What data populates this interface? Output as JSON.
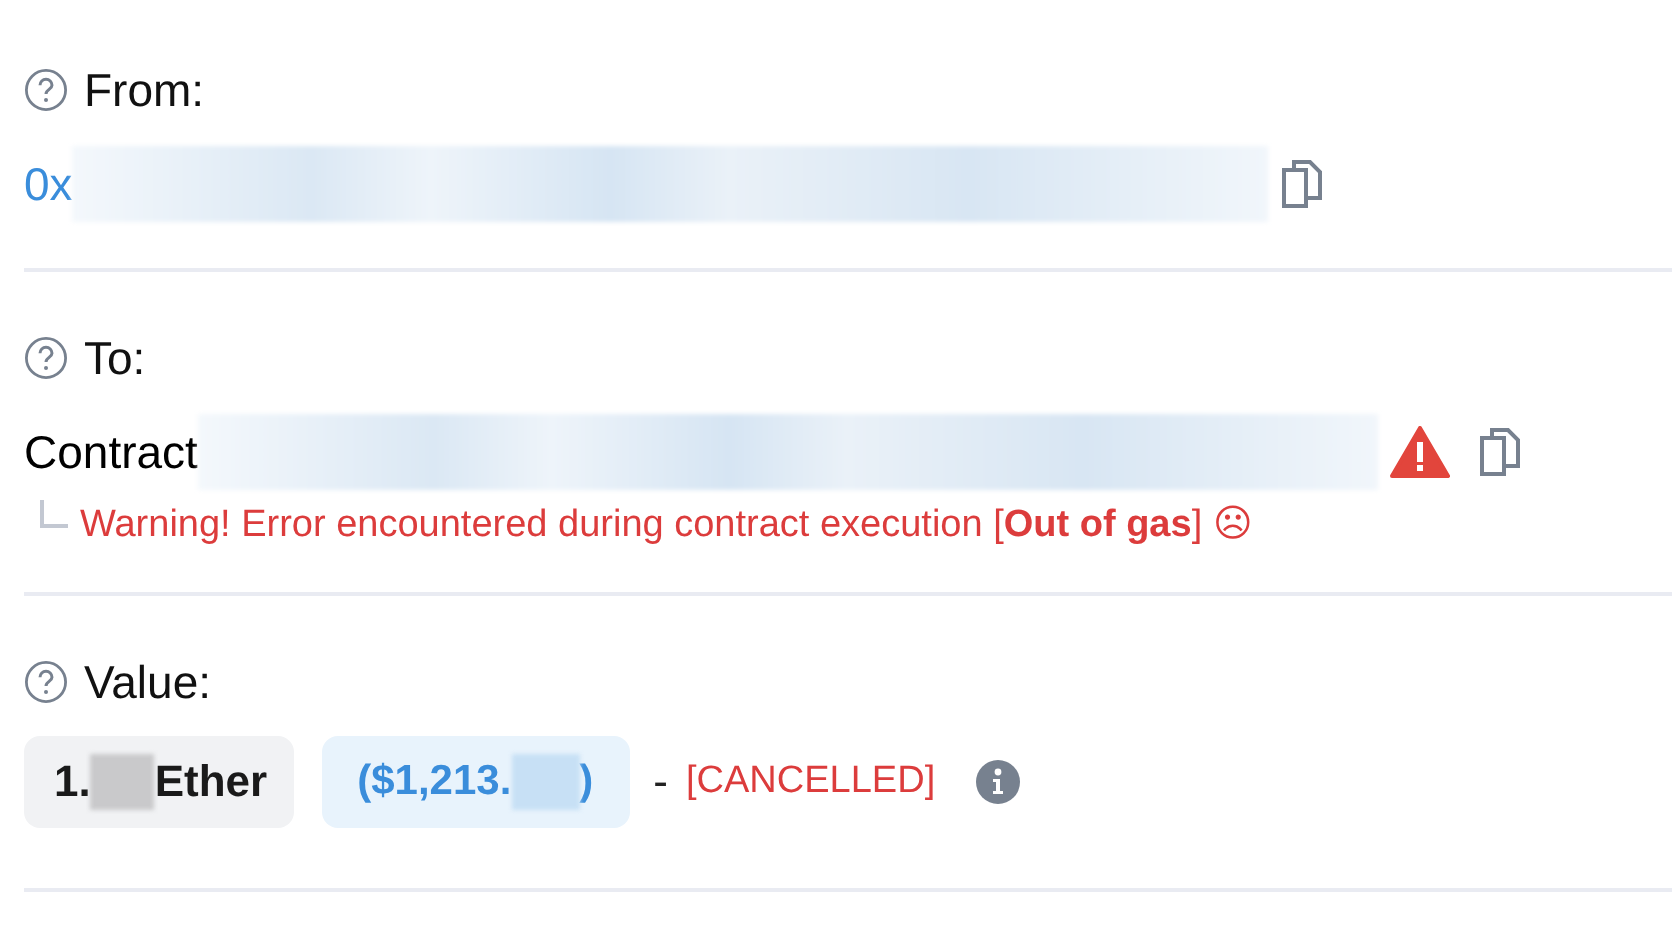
{
  "from": {
    "label": "From:",
    "address_prefix": "0x"
  },
  "to": {
    "label": "To:",
    "address_prefix": "Contract",
    "warning": "Warning! Error encountered during contract execution [**Out of gas**] ☹"
  },
  "value": {
    "label": "Value:",
    "amount_prefix": "1.",
    "amount_unit": "Ether",
    "fiat_prefix": "($1,213.",
    "fiat_suffix": ")",
    "separator": "-",
    "status": "[CANCELLED]"
  }
}
